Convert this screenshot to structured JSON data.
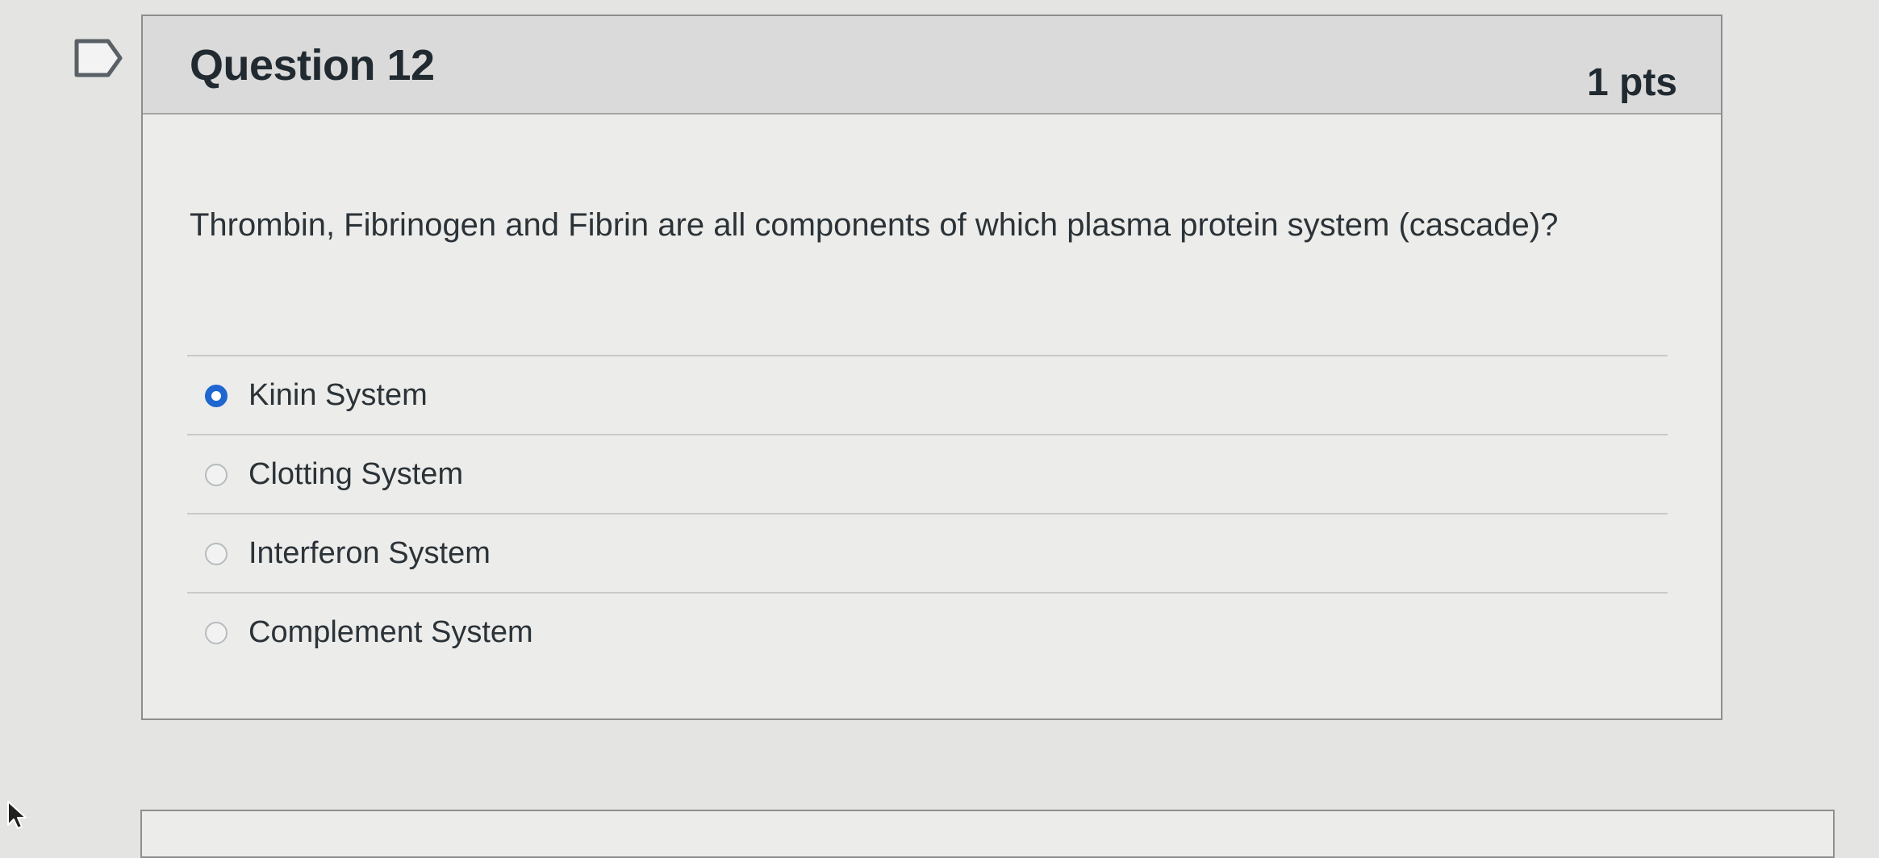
{
  "question": {
    "title": "Question 12",
    "points": "1 pts",
    "text": "Thrombin, Fibrinogen and Fibrin are all components of which plasma protein system (cascade)?",
    "answers": [
      {
        "label": "Kinin System",
        "selected": true
      },
      {
        "label": "Clotting System",
        "selected": false
      },
      {
        "label": "Interferon System",
        "selected": false
      },
      {
        "label": "Complement System",
        "selected": false
      }
    ]
  },
  "icons": {
    "flag": "flag-icon",
    "cursor": "cursor-icon"
  },
  "colors": {
    "selected_radio": "#1f66d1",
    "header_background": "#dadada"
  }
}
